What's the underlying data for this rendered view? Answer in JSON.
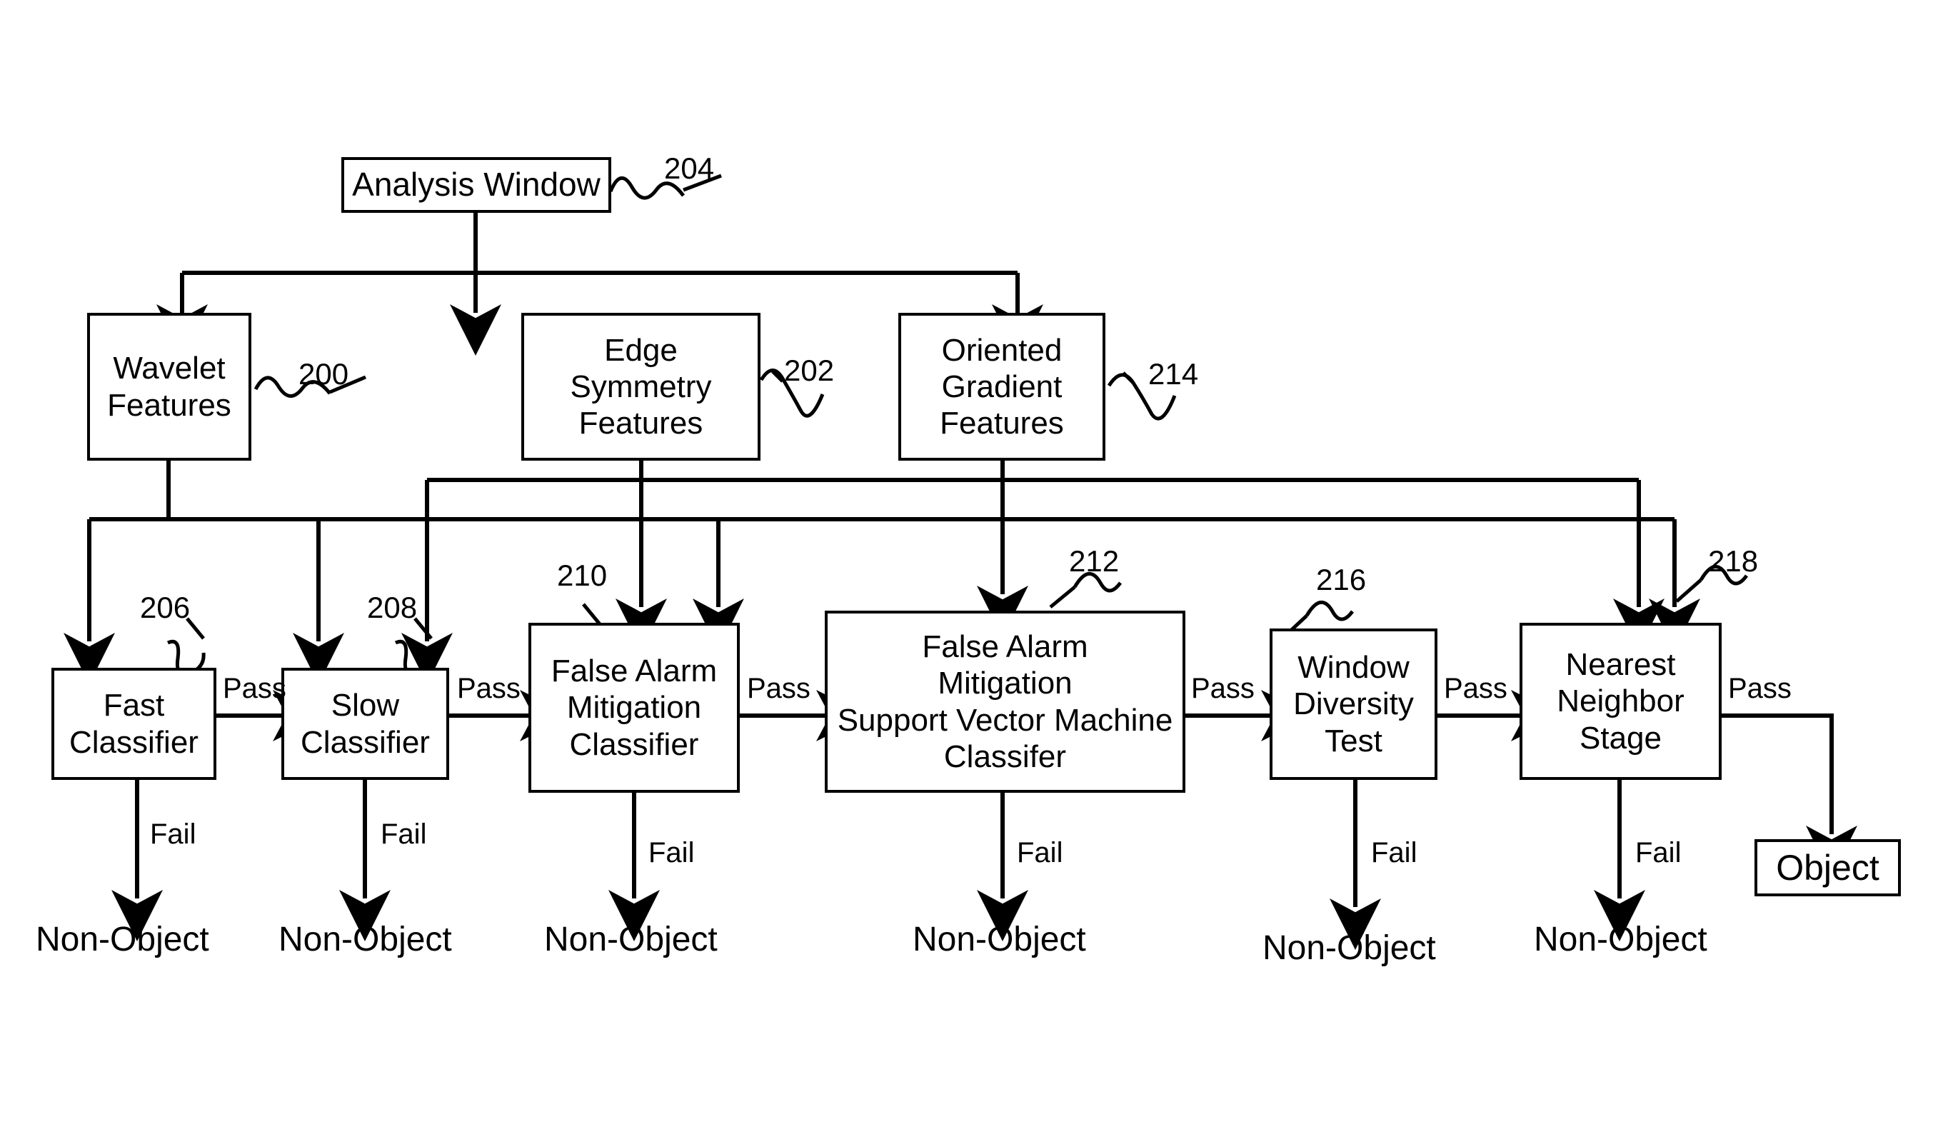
{
  "diagram": {
    "title": "Object Detection Cascade",
    "stroke_color": "#000000",
    "background_color": "#ffffff"
  },
  "nodes": {
    "analysis_window": {
      "label": "Analysis Window",
      "ref": "204"
    },
    "wavelet_features": {
      "label": "Wavelet\nFeatures",
      "ref": "200"
    },
    "edge_symmetry_features": {
      "label": "Edge\nSymmetry\nFeatures",
      "ref": "202"
    },
    "oriented_gradient_features": {
      "label": "Oriented\nGradient\nFeatures",
      "ref": "214"
    },
    "fast_classifier": {
      "label": "Fast\nClassifier",
      "ref": "206"
    },
    "slow_classifier": {
      "label": "Slow\nClassifier",
      "ref": "208"
    },
    "false_alarm_mitigation_classifier": {
      "label": "False Alarm\nMitigation\nClassifier",
      "ref": "210"
    },
    "false_alarm_svm_classifier": {
      "label": "False Alarm\nMitigation\nSupport Vector Machine\nClassifer",
      "ref": "212"
    },
    "window_diversity_test": {
      "label": "Window\nDiversity\nTest",
      "ref": "216"
    },
    "nearest_neighbor_stage": {
      "label": "Nearest\nNeighbor\nStage",
      "ref": "218"
    },
    "object": {
      "label": "Object"
    }
  },
  "edge_labels": {
    "pass": "Pass",
    "fail": "Fail"
  },
  "pass_labels": [
    "Pass",
    "Pass",
    "Pass",
    "Pass",
    "Pass",
    "Pass"
  ],
  "fail_labels": [
    "Fail",
    "Fail",
    "Fail",
    "Fail",
    "Fail",
    "Fail"
  ],
  "terminals": {
    "non_object": "Non-Object",
    "non_object_list": [
      "Non-Object",
      "Non-Object",
      "Non-Object",
      "Non-Object",
      "Non-Object",
      "Non-Object"
    ]
  },
  "reference_numerals": [
    "200",
    "202",
    "204",
    "206",
    "208",
    "210",
    "212",
    "214",
    "216",
    "218"
  ]
}
